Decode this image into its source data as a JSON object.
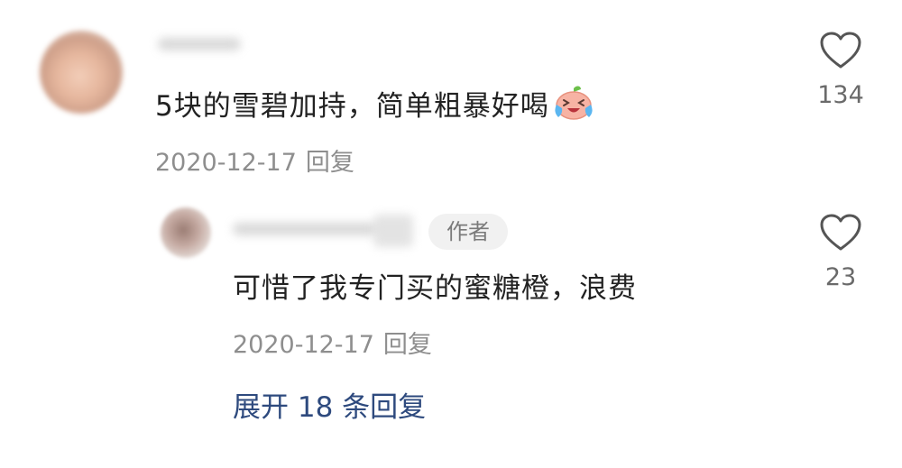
{
  "comment": {
    "avatar_icon": "blurred-user-avatar",
    "text": "5块的雪碧加持，简单粗暴好喝",
    "emoji_icon": "crying-laughing-emoji",
    "date": "2020-12-17",
    "reply_label": "回复",
    "like_icon": "heart-outline-icon",
    "likes": "134"
  },
  "reply": {
    "avatar_icon": "blurred-user-avatar",
    "author_badge": "作者",
    "text": "可惜了我专门买的蜜糖橙，浪费",
    "date": "2020-12-17",
    "reply_label": "回复",
    "like_icon": "heart-outline-icon",
    "likes": "23"
  },
  "expand_replies_label": "展开 18 条回复",
  "colors": {
    "text": "#222222",
    "meta": "#8e8e8e",
    "link": "#2e4a7e",
    "badge_bg": "#f1f1f1"
  }
}
